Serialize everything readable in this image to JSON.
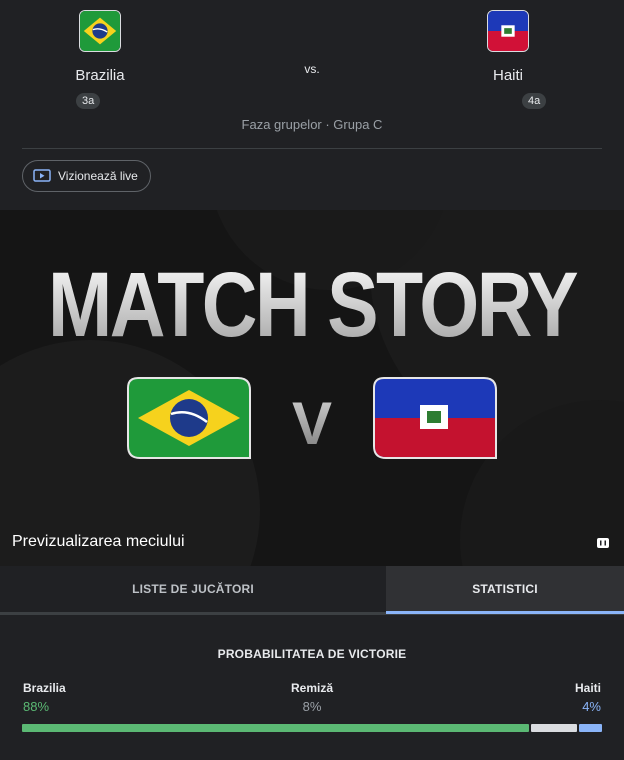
{
  "match": {
    "home": {
      "name": "Brazilia",
      "seed": "3a",
      "flag_icon": "brazil-flag-icon"
    },
    "away": {
      "name": "Haiti",
      "seed": "4a",
      "flag_icon": "haiti-flag-icon"
    },
    "vs_label": "vs.",
    "stage": "Faza grupelor · Grupa C",
    "watch_label": "Vizionează live"
  },
  "video": {
    "headline": "MATCH STORY",
    "versus": "V",
    "caption": "Previzualizarea meciului"
  },
  "tabs": [
    {
      "label": "LISTE DE JUCĂTORI",
      "active": false
    },
    {
      "label": "STATISTICI",
      "active": true
    }
  ],
  "stats": {
    "title": "PROBABILITATEA DE VICTORIE",
    "home": {
      "label": "Brazilia",
      "value": "88%",
      "percent": 88,
      "color": "#5bb974"
    },
    "draw": {
      "label": "Remiză",
      "value": "8%",
      "percent": 8,
      "color": "#dadce0"
    },
    "away": {
      "label": "Haiti",
      "value": "4%",
      "percent": 4,
      "color": "#8ab4f8"
    }
  },
  "colors": {
    "background": "#202124",
    "accent_blue": "#8ab4f8",
    "win_green": "#5bb974",
    "muted_text": "#9aa0a6"
  }
}
